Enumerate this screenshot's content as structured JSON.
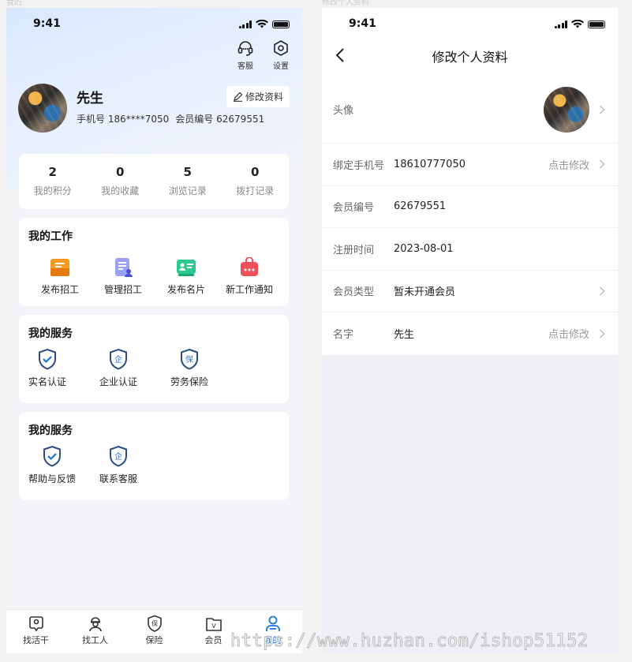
{
  "artboards": {
    "left_label": "我的",
    "right_label": "修改个人资料"
  },
  "status": {
    "time": "9:41"
  },
  "profile": {
    "support_label": "客服",
    "settings_label": "设置",
    "name": "先生",
    "phone_label": "手机号",
    "phone": "186****7050",
    "member_no_label": "会员编号",
    "member_no": "62679551",
    "edit_label": "修改资料"
  },
  "stats": [
    {
      "value": "2",
      "label": "我的积分"
    },
    {
      "value": "0",
      "label": "我的收藏"
    },
    {
      "value": "5",
      "label": "浏览记录"
    },
    {
      "value": "0",
      "label": "拨打记录"
    }
  ],
  "work": {
    "title": "我的工作",
    "items": [
      {
        "label": "发布招工",
        "icon": "post-job-icon"
      },
      {
        "label": "管理招工",
        "icon": "manage-job-icon"
      },
      {
        "label": "发布名片",
        "icon": "business-card-icon"
      },
      {
        "label": "新工作通知",
        "icon": "job-notice-icon"
      }
    ]
  },
  "services": {
    "title": "我的服务",
    "items": [
      {
        "label": "实名认证",
        "icon": "shield-check-icon"
      },
      {
        "label": "企业认证",
        "icon": "shield-enterprise-icon",
        "glyph": "企"
      },
      {
        "label": "劳务保险",
        "icon": "shield-insurance-icon",
        "glyph": "保"
      }
    ]
  },
  "services2": {
    "title": "我的服务",
    "items": [
      {
        "label": "帮助与反馈",
        "icon": "shield-check-icon"
      },
      {
        "label": "联系客服",
        "icon": "shield-enterprise-icon",
        "glyph": "企"
      }
    ]
  },
  "tabbar": [
    {
      "label": "找活干",
      "icon": "find-work-icon"
    },
    {
      "label": "找工人",
      "icon": "find-worker-icon"
    },
    {
      "label": "保险",
      "icon": "insurance-icon",
      "glyph": "保"
    },
    {
      "label": "会员",
      "icon": "member-icon",
      "glyph": "V"
    },
    {
      "label": "我的",
      "icon": "mine-icon",
      "active": true
    }
  ],
  "edit_page": {
    "title": "修改个人资料",
    "rows": [
      {
        "label": "头像",
        "value": "",
        "action": ""
      },
      {
        "label": "绑定手机号",
        "value": "18610777050",
        "action": "点击修改"
      },
      {
        "label": "会员编号",
        "value": "62679551",
        "action": ""
      },
      {
        "label": "注册时间",
        "value": "2023-08-01",
        "action": ""
      },
      {
        "label": "会员类型",
        "value": "暂未开通会员",
        "action": ""
      },
      {
        "label": "名字",
        "value": "先生",
        "action": "点击修改"
      }
    ]
  },
  "watermark": "https://www.huzhan.com/ishop51152",
  "colors": {
    "accent": "#1a73e8",
    "orange": "#f59a23",
    "purple": "#7c7cf0",
    "green": "#2ec98f",
    "red": "#f0505a",
    "shield": "#2b4d86"
  }
}
